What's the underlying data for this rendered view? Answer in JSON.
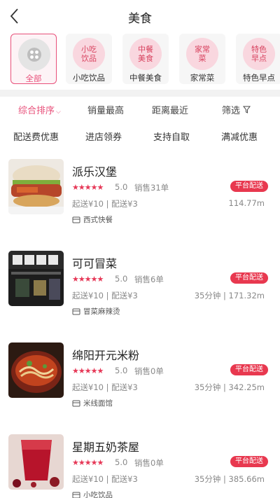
{
  "header": {
    "title": "美食"
  },
  "categories": [
    {
      "label": "全部",
      "circle": "",
      "icon": "grid-icon",
      "active": true
    },
    {
      "label": "小吃饮品",
      "circle": "小吃\n饮品"
    },
    {
      "label": "中餐美食",
      "circle": "中餐\n美食"
    },
    {
      "label": "家常菜",
      "circle": "家常\n菜"
    },
    {
      "label": "特色早点",
      "circle": "特色\n早点"
    }
  ],
  "sort": {
    "items": [
      "综合排序",
      "销量最高",
      "距离最近",
      "筛选"
    ],
    "active_index": 0
  },
  "filters": [
    "配送费优惠",
    "进店领券",
    "支持自取",
    "满减优惠"
  ],
  "shops": [
    {
      "name": "派乐汉堡",
      "stars": "★★★★★",
      "rating": "5.0",
      "sales": "销售31单",
      "badge": "平台配送",
      "delivery": "起送¥10 | 配送¥3",
      "distance": "114.77m",
      "tag": "西式快餐",
      "image": "burger"
    },
    {
      "name": "可可冒菜",
      "stars": "★★★★★",
      "rating": "5.0",
      "sales": "销售6单",
      "badge": "平台配送",
      "delivery": "起送¥10 | 配送¥3",
      "distance": "35分钟 | 171.32m",
      "tag": "冒菜麻辣烫",
      "image": "storefront"
    },
    {
      "name": "绵阳开元米粉",
      "stars": "★★★★★",
      "rating": "5.0",
      "sales": "销售0单",
      "badge": "平台配送",
      "delivery": "起送¥10 | 配送¥3",
      "distance": "35分钟 | 342.25m",
      "tag": "米线面馆",
      "image": "noodles"
    },
    {
      "name": "星期五奶茶屋",
      "stars": "★★★★★",
      "rating": "5.0",
      "sales": "销售0单",
      "badge": "平台配送",
      "delivery": "起送¥10 | 配送¥3",
      "distance": "35分钟 | 385.66m",
      "tag": "小吃饮品",
      "image": "red-drink"
    }
  ],
  "colors": {
    "accent": "#e8507a",
    "badge": "#e8384f",
    "star": "#e63857"
  }
}
